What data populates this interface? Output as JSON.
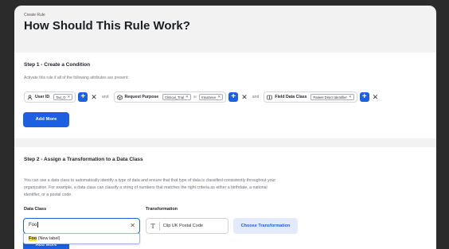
{
  "header": {
    "breadcrumb": "Create Rule",
    "title": "How Should This Rule Work?"
  },
  "step1": {
    "title": "Step 1 - Create a Condition",
    "subtitle": "Activate this rule if all of the following attributes are present:",
    "user_id": {
      "label": "User ID",
      "chips": [
        "Tao_G"
      ]
    },
    "and1": "and",
    "purpose": {
      "label": "Request Purpose",
      "chips": [
        "Clinical_Trial",
        "Insurance"
      ],
      "or": "or"
    },
    "and2": "and",
    "field": {
      "label": "Field Data Class",
      "chips": [
        "Patient Direct Identifier"
      ]
    },
    "add_more": "Add More"
  },
  "step2": {
    "title": "Step 2 - Assign a Transformation to a Data Class",
    "description": "You can use a data class to automatically identify a type of data and ensure that that type of data is classified consistently throughout your organization. For example, a data class can classify a string of numbers that matches the right criteria as either a birthdate, a national identifier, or a postal code.",
    "data_class_label": "Data Class",
    "data_class_value": "Foo",
    "suggestion_match": "Foo",
    "suggestion_rest": " (New label)",
    "transformation_label": "Transformation",
    "transformation_value": "Clip UK Postal Code",
    "choose_button": "Choose Transformation",
    "add_more": "Add More"
  },
  "colors": {
    "accent": "#1c5fe0",
    "highlight": "#f5e54a"
  },
  "icons": [
    "user-icon",
    "purpose-icon",
    "field-class-icon",
    "close-icon",
    "plus-icon",
    "clear-icon",
    "text-type-icon"
  ]
}
